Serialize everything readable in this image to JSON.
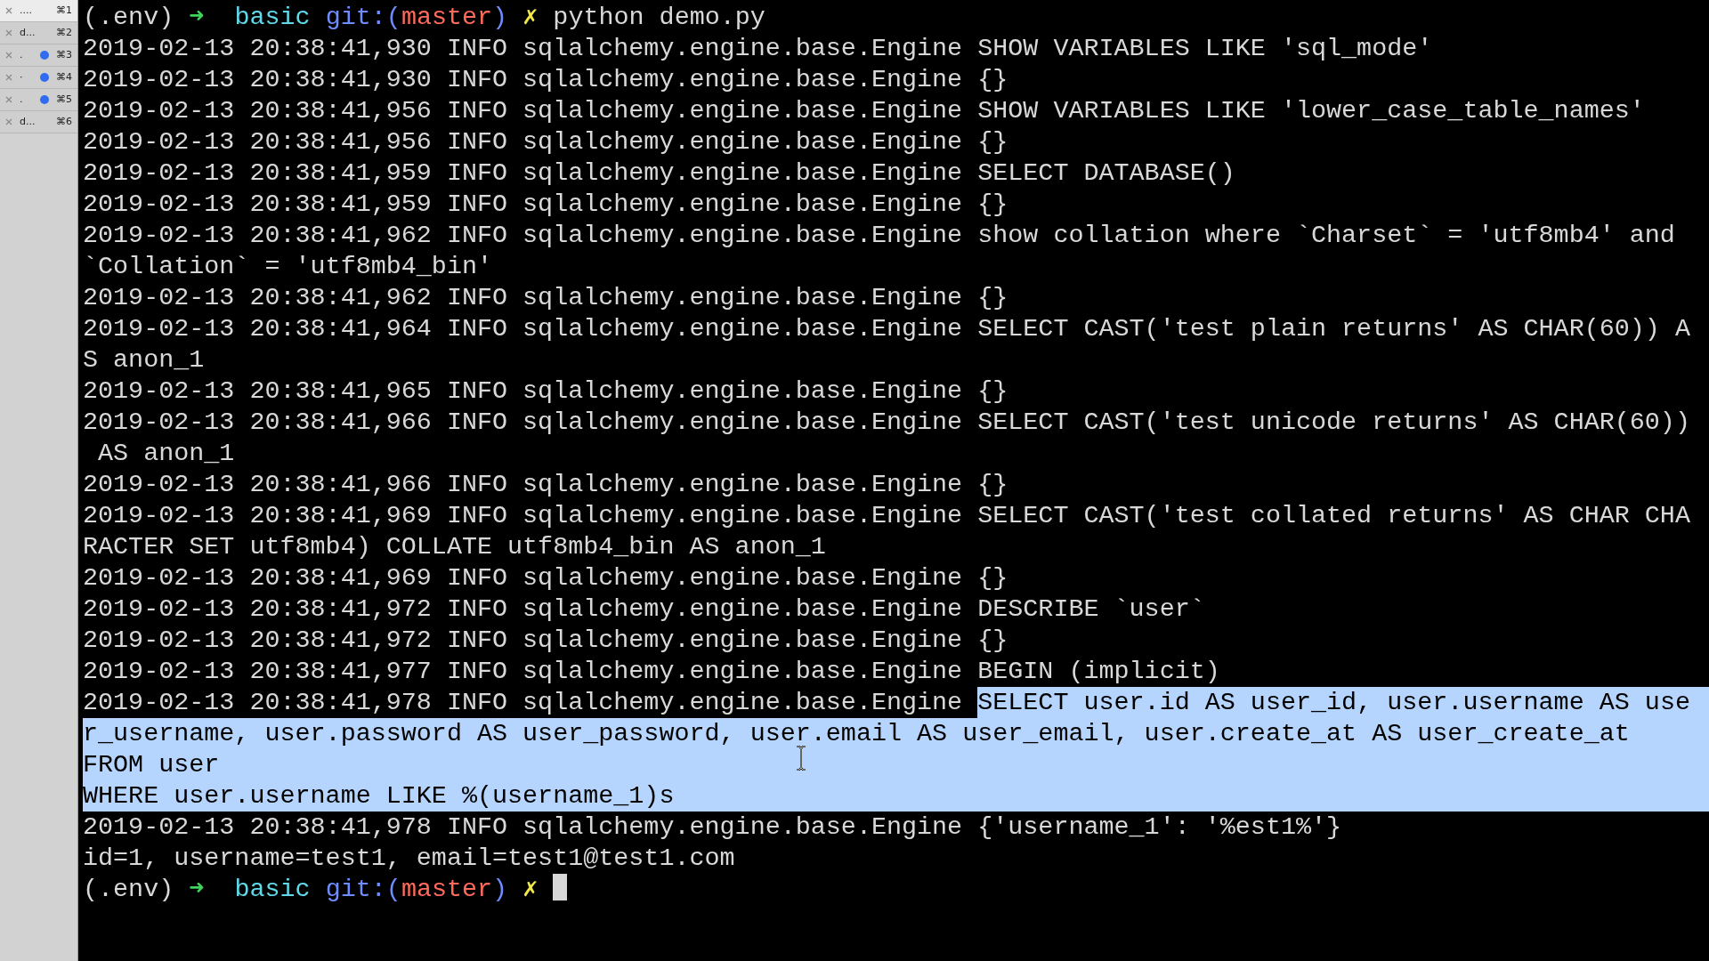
{
  "tabs": [
    {
      "label": "....",
      "shortcut": "⌘1",
      "selected": true,
      "activity": false
    },
    {
      "label": "d...",
      "shortcut": "⌘2",
      "selected": false,
      "activity": false
    },
    {
      "label": ".",
      "shortcut": "⌘3",
      "selected": false,
      "activity": true
    },
    {
      "label": "·",
      "shortcut": "⌘4",
      "selected": false,
      "activity": true
    },
    {
      "label": ".",
      "shortcut": "⌘5",
      "selected": false,
      "activity": true
    },
    {
      "label": "d...",
      "shortcut": "⌘6",
      "selected": false,
      "activity": false
    }
  ],
  "terminal": {
    "lines": [
      {
        "kind": "prompt",
        "env": "(.env)",
        "arrow": "➜",
        "directory": "basic",
        "git_prefix": "git:(",
        "branch": "master",
        "git_suffix": ")",
        "dirty": "✗",
        "command": "python demo.py",
        "cursor": false
      },
      {
        "kind": "output",
        "text": "2019-02-13 20:38:41,930 INFO sqlalchemy.engine.base.Engine SHOW VARIABLES LIKE 'sql_mode'",
        "selected": false
      },
      {
        "kind": "output",
        "text": "2019-02-13 20:38:41,930 INFO sqlalchemy.engine.base.Engine {}",
        "selected": false
      },
      {
        "kind": "output",
        "text": "2019-02-13 20:38:41,956 INFO sqlalchemy.engine.base.Engine SHOW VARIABLES LIKE 'lower_case_table_names'",
        "selected": false
      },
      {
        "kind": "output",
        "text": "2019-02-13 20:38:41,956 INFO sqlalchemy.engine.base.Engine {}",
        "selected": false
      },
      {
        "kind": "output",
        "text": "2019-02-13 20:38:41,959 INFO sqlalchemy.engine.base.Engine SELECT DATABASE()",
        "selected": false
      },
      {
        "kind": "output",
        "text": "2019-02-13 20:38:41,959 INFO sqlalchemy.engine.base.Engine {}",
        "selected": false
      },
      {
        "kind": "output",
        "text": "2019-02-13 20:38:41,962 INFO sqlalchemy.engine.base.Engine show collation where `Charset` = 'utf8mb4' and",
        "selected": false
      },
      {
        "kind": "output",
        "text": "`Collation` = 'utf8mb4_bin'",
        "selected": false
      },
      {
        "kind": "output",
        "text": "2019-02-13 20:38:41,962 INFO sqlalchemy.engine.base.Engine {}",
        "selected": false
      },
      {
        "kind": "output",
        "text": "2019-02-13 20:38:41,964 INFO sqlalchemy.engine.base.Engine SELECT CAST('test plain returns' AS CHAR(60)) A",
        "selected": false
      },
      {
        "kind": "output",
        "text": "S anon_1",
        "selected": false
      },
      {
        "kind": "output",
        "text": "2019-02-13 20:38:41,965 INFO sqlalchemy.engine.base.Engine {}",
        "selected": false
      },
      {
        "kind": "output",
        "text": "2019-02-13 20:38:41,966 INFO sqlalchemy.engine.base.Engine SELECT CAST('test unicode returns' AS CHAR(60))",
        "selected": false
      },
      {
        "kind": "output",
        "text": " AS anon_1",
        "selected": false
      },
      {
        "kind": "output",
        "text": "2019-02-13 20:38:41,966 INFO sqlalchemy.engine.base.Engine {}",
        "selected": false
      },
      {
        "kind": "output",
        "text": "2019-02-13 20:38:41,969 INFO sqlalchemy.engine.base.Engine SELECT CAST('test collated returns' AS CHAR CHA",
        "selected": false
      },
      {
        "kind": "output",
        "text": "RACTER SET utf8mb4) COLLATE utf8mb4_bin AS anon_1",
        "selected": false
      },
      {
        "kind": "output",
        "text": "2019-02-13 20:38:41,969 INFO sqlalchemy.engine.base.Engine {}",
        "selected": false
      },
      {
        "kind": "output",
        "text": "2019-02-13 20:38:41,972 INFO sqlalchemy.engine.base.Engine DESCRIBE `user`",
        "selected": false
      },
      {
        "kind": "output",
        "text": "2019-02-13 20:38:41,972 INFO sqlalchemy.engine.base.Engine {}",
        "selected": false
      },
      {
        "kind": "output",
        "text": "2019-02-13 20:38:41,977 INFO sqlalchemy.engine.base.Engine BEGIN (implicit)",
        "selected": false
      },
      {
        "kind": "output",
        "text": "2019-02-13 20:38:41,978 INFO sqlalchemy.engine.base.Engine",
        "selected": false,
        "selected_text": "SELECT user.id AS user_id, user.username AS use"
      },
      {
        "kind": "output",
        "text": "r_username, user.password AS user_password, user.email AS user_email, user.create_at AS user_create_at",
        "selected": true
      },
      {
        "kind": "output",
        "text": "FROM user",
        "selected": true
      },
      {
        "kind": "output",
        "text": "WHERE user.username LIKE %(username_1)s",
        "selected": true
      },
      {
        "kind": "output",
        "text": "2019-02-13 20:38:41,978 INFO sqlalchemy.engine.base.Engine {'username_1': '%est1%'}",
        "selected": false
      },
      {
        "kind": "output",
        "text": "id=1, username=test1, email=test1@test1.com",
        "selected": false
      },
      {
        "kind": "prompt",
        "env": "(.env)",
        "arrow": "➜",
        "directory": "basic",
        "git_prefix": "git:(",
        "branch": "master",
        "git_suffix": ")",
        "dirty": "✗",
        "cursor": true
      }
    ]
  }
}
